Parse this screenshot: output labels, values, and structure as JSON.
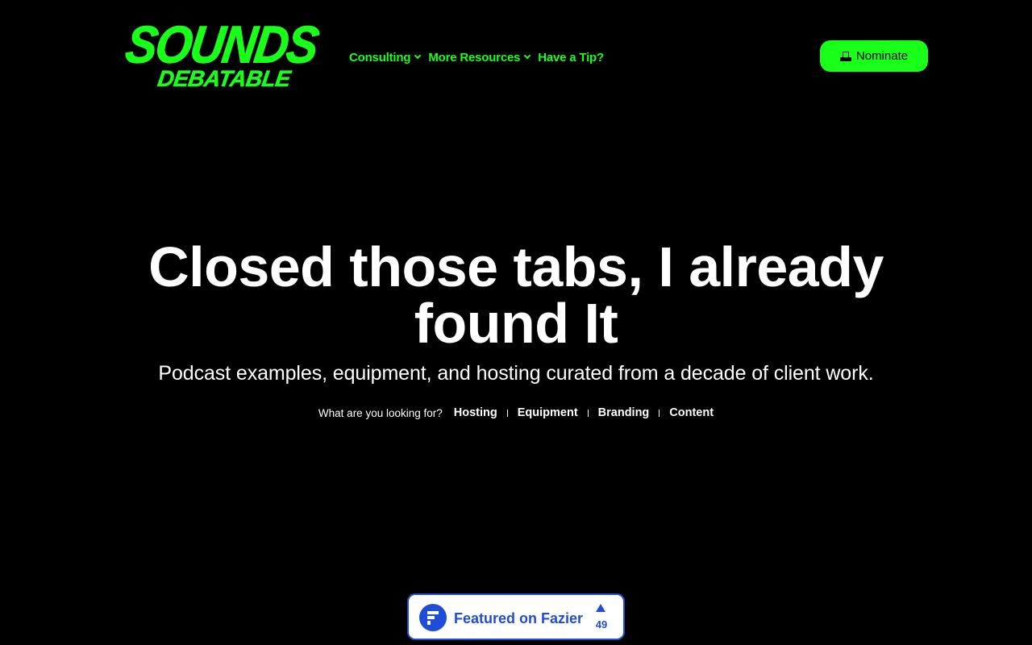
{
  "brand": {
    "logo_line1": "SOUNDS",
    "logo_line2": "DEBATABLE",
    "accent_color": "#19ff1a"
  },
  "nav": {
    "items": [
      {
        "label": "Consulting",
        "has_dropdown": true
      },
      {
        "label": "More Resources",
        "has_dropdown": true
      },
      {
        "label": "Have a Tip?",
        "has_dropdown": false
      }
    ]
  },
  "header": {
    "nominate_label": "Nominate",
    "nominate_icon": "ballot-box-icon"
  },
  "hero": {
    "title": "Closed those tabs, I already found It",
    "subtitle": "Podcast examples, equipment, and hosting curated from a decade of client work."
  },
  "quick_links": {
    "prompt": "What are you looking for?",
    "links": [
      "Hosting",
      "Equipment",
      "Branding",
      "Content"
    ]
  },
  "badge": {
    "text": "Featured on Fazier",
    "upvotes": "49",
    "color": "#1f4dd8"
  }
}
